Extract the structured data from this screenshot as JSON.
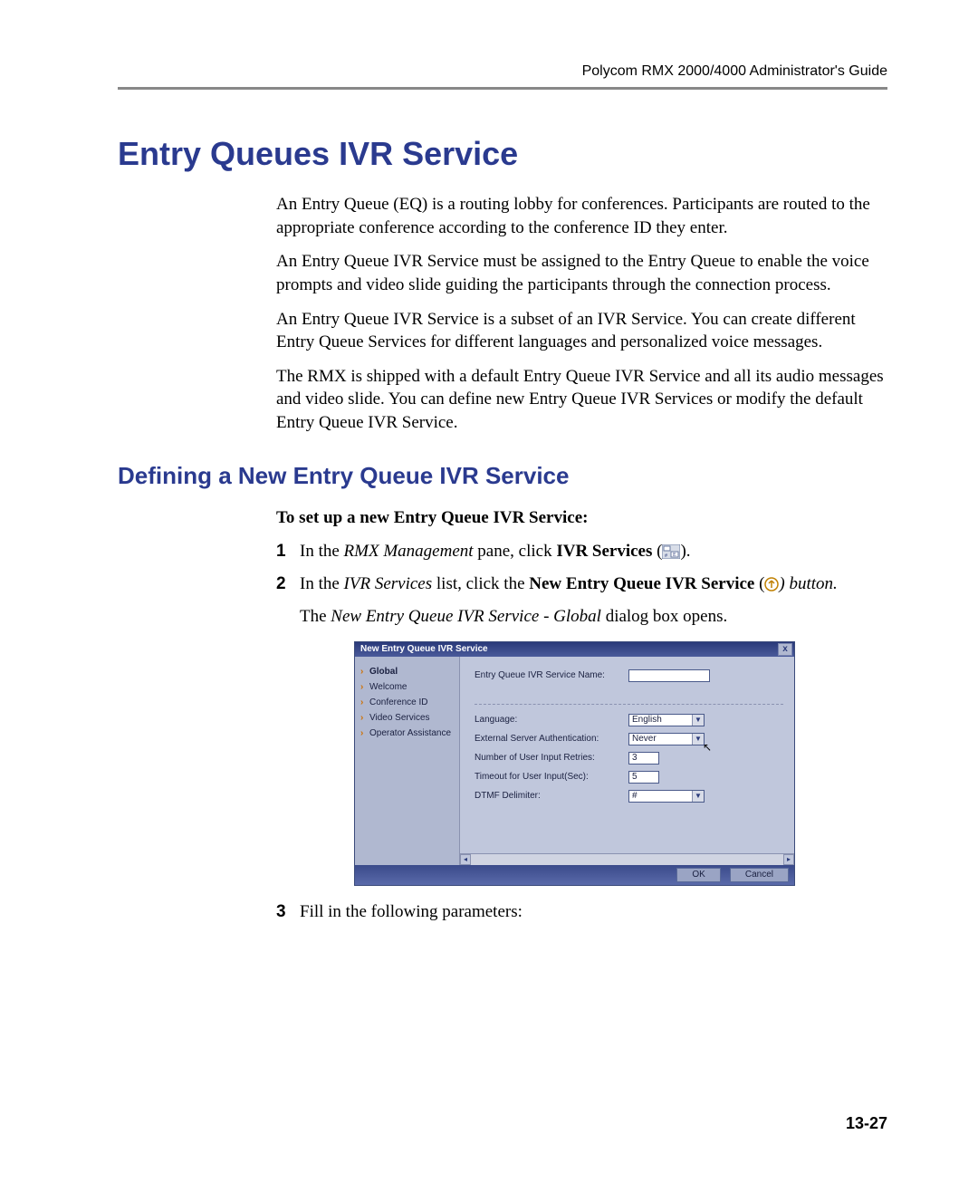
{
  "header": {
    "doc_title": "Polycom RMX 2000/4000 Administrator's Guide"
  },
  "h1": "Entry Queues IVR Service",
  "paragraphs": {
    "p1": "An Entry Queue (EQ) is a routing lobby for conferences. Participants are routed to the appropriate conference according to the conference ID they enter.",
    "p2": "An Entry Queue IVR Service must be assigned to the Entry Queue to enable the voice prompts and video slide guiding the participants through the connection process.",
    "p3": "An Entry Queue IVR Service is a subset of an IVR Service. You can create different Entry Queue Services for different languages and personalized voice messages.",
    "p4": "The RMX is shipped with a default Entry Queue IVR Service and all its audio messages and video slide. You can define new Entry Queue IVR Services or modify the default Entry Queue IVR Service."
  },
  "h2": "Defining a New Entry Queue IVR Service",
  "instr_title": "To set up a new Entry Queue IVR Service:",
  "steps": {
    "s1_num": "1",
    "s1_a": "In the ",
    "s1_b": "RMX Management",
    "s1_c": " pane, click ",
    "s1_d": "IVR Services",
    "s1_e": " (",
    "s1_f": ").",
    "s2_num": "2",
    "s2_a": "In the ",
    "s2_b": "IVR Services",
    "s2_c": " list, click the ",
    "s2_d": "New Entry Queue IVR Service",
    "s2_e": " (",
    "s2_f": ") button.",
    "s2_follow_a": "The ",
    "s2_follow_b": "New Entry Queue IVR Service - Global",
    "s2_follow_c": " dialog box opens.",
    "s3_num": "3",
    "s3_text": "Fill in the following parameters:"
  },
  "dialog": {
    "title": "New Entry Queue IVR Service",
    "close": "x",
    "nav": {
      "n0": "Global",
      "n1": "Welcome",
      "n2": "Conference ID",
      "n3": "Video Services",
      "n4": "Operator Assistance"
    },
    "fields": {
      "service_name_label": "Entry Queue IVR Service Name:",
      "service_name_value": "",
      "language_label": "Language:",
      "language_value": "English",
      "ext_auth_label": "External Server Authentication:",
      "ext_auth_value": "Never",
      "retries_label": "Number of User Input Retries:",
      "retries_value": "3",
      "timeout_label": "Timeout for User Input(Sec):",
      "timeout_value": "5",
      "dtmf_label": "DTMF Delimiter:",
      "dtmf_value": "#"
    },
    "buttons": {
      "ok": "OK",
      "cancel": "Cancel"
    }
  },
  "page_number": "13-27"
}
